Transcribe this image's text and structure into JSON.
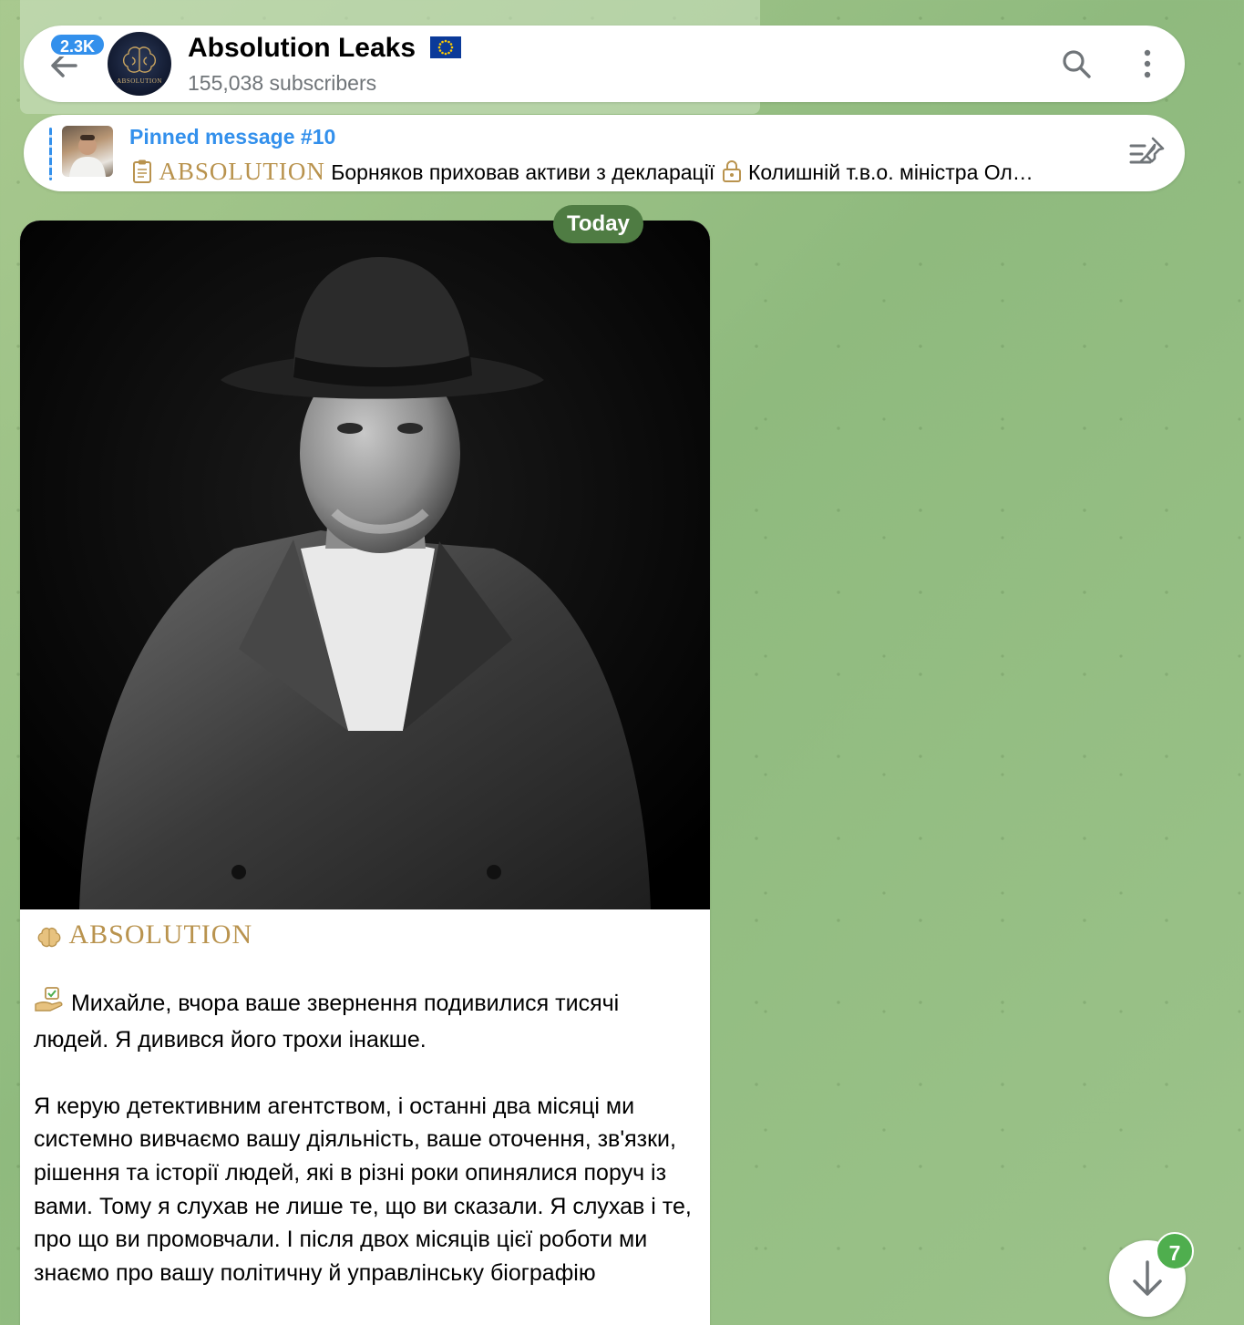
{
  "header": {
    "unread_count": "2.3K",
    "channel_name": "Absolution Leaks",
    "channel_flag": "EU flag",
    "subscribers": "155,038 subscribers",
    "avatar_label": "ABSOLUTION",
    "icons": {
      "back": "arrow-left-icon",
      "search": "search-icon",
      "more": "more-vertical-icon"
    }
  },
  "pinned": {
    "title": "Pinned message #10",
    "brand": "ABSOLUTION",
    "text": "Борняков приховав активи з декларації",
    "text2": "Колишній т.в.о. міністра Ол…",
    "icons": {
      "clipboard": "clipboard-icon",
      "lock": "lock-icon",
      "pin_list": "pin-list-icon"
    }
  },
  "date_chip": "Today",
  "message": {
    "brand": "ABSOLUTION",
    "paragraphs": [
      "Михайле, вчора ваше звернення подивилися тисячі людей. Я дивився його трохи інакше.",
      "Я керую детективним агентством, і останні два місяці ми системно вивчаємо вашу діяльність, ваше оточення, зв'язки, рішення та історії людей, які в різні роки опинялися поруч із вами. Тому я слухав не лише те, що ви сказали. Я слухав і те, про що ви промовчали. І після двох місяців цієї роботи ми знаємо про вашу політичну й управлінську біографію"
    ],
    "icons": {
      "brain": "brain-icon",
      "hand_check": "hand-checkmark-icon"
    }
  },
  "scroll": {
    "badge": "7",
    "icon": "arrow-down-icon"
  },
  "colors": {
    "accent": "#3390ec",
    "brand_gold": "#b9934e",
    "date_chip_bg": "#4f7c43",
    "badge_green": "#4fae4e",
    "wallpaper": "#9cc38a"
  }
}
